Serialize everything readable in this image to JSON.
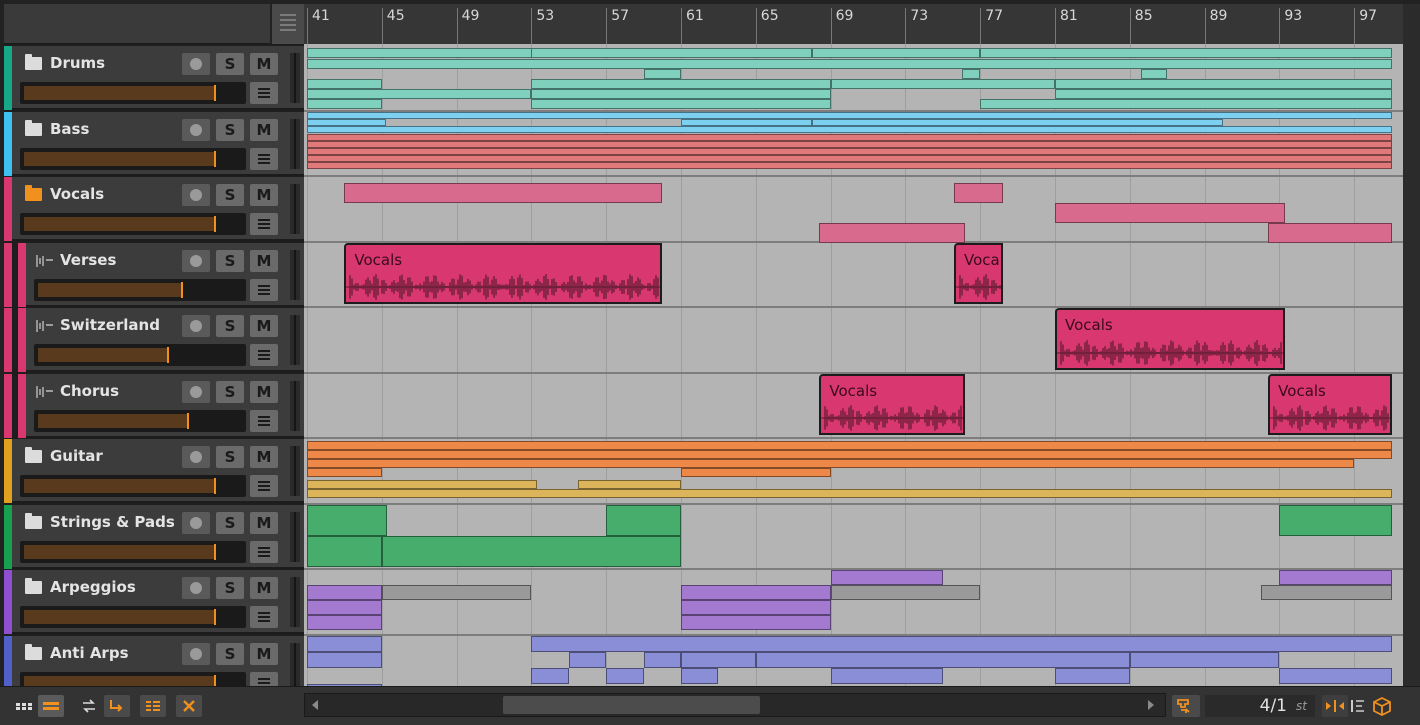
{
  "ruler": {
    "bars": [
      "41",
      "45",
      "49",
      "53",
      "57",
      "61",
      "65",
      "69",
      "73",
      "77",
      "81",
      "85",
      "89",
      "93",
      "97"
    ]
  },
  "tracks": [
    {
      "name": "Drums",
      "color": "#17a88a",
      "type": "folder",
      "indent": false,
      "rec": "",
      "solo": "S",
      "mute": "M",
      "volume": 0.87
    },
    {
      "name": "Bass",
      "color": "#3ec1ee",
      "type": "folder",
      "indent": false,
      "rec": "",
      "solo": "S",
      "mute": "M",
      "volume": 0.87
    },
    {
      "name": "Vocals",
      "color": "#d9376f",
      "type": "folder-open",
      "indent": false,
      "rec": "",
      "solo": "S",
      "mute": "M",
      "volume": 0.87
    },
    {
      "name": "Verses",
      "color": "#d9376f",
      "type": "audio",
      "indent": true,
      "rec": "",
      "solo": "S",
      "mute": "M",
      "volume": 0.7
    },
    {
      "name": "Switzerland",
      "color": "#d9376f",
      "type": "audio",
      "indent": true,
      "rec": "",
      "solo": "S",
      "mute": "M",
      "volume": 0.63
    },
    {
      "name": "Chorus",
      "color": "#d9376f",
      "type": "audio",
      "indent": true,
      "rec": "",
      "solo": "S",
      "mute": "M",
      "volume": 0.73
    },
    {
      "name": "Guitar",
      "color": "#e0a020",
      "type": "folder",
      "indent": false,
      "rec": "",
      "solo": "S",
      "mute": "M",
      "volume": 0.87
    },
    {
      "name": "Strings & Pads",
      "color": "#18a050",
      "type": "folder",
      "indent": false,
      "rec": "",
      "solo": "S",
      "mute": "M",
      "volume": 0.87
    },
    {
      "name": "Arpeggios",
      "color": "#8e50d0",
      "type": "folder",
      "indent": false,
      "rec": "",
      "solo": "S",
      "mute": "M",
      "volume": 0.87
    },
    {
      "name": "Anti Arps",
      "color": "#5060c8",
      "type": "folder",
      "indent": false,
      "rec": "",
      "solo": "S",
      "mute": "M",
      "volume": 0.87
    }
  ],
  "audio_clips": [
    {
      "label": "Vocals",
      "lane": 3,
      "start": 43,
      "end": 60
    },
    {
      "label": "Voca",
      "lane": 3,
      "start": 75.6,
      "end": 78.2
    },
    {
      "label": "Vocals",
      "lane": 4,
      "start": 81,
      "end": 93.3
    },
    {
      "label": "Vocals",
      "lane": 5,
      "start": 68.4,
      "end": 76.2
    },
    {
      "label": "Vocals",
      "lane": 5,
      "start": 92.4,
      "end": 99
    }
  ],
  "toolbar": {
    "zoom_value": "4/1",
    "zoom_unit": "st"
  },
  "colors": {
    "drums": "#7fd0bd",
    "bass": "#7ed0f0",
    "bass_red": "#e07a7a",
    "vocals": "#d86a8e",
    "guitar_orange": "#ee8848",
    "guitar_yellow": "#dcb45a",
    "strings": "#46ad6c",
    "arp": "#a37ad0",
    "arp_gray": "#9a9a9a",
    "anti": "#8a8ed6",
    "accent": "#f0901e"
  }
}
